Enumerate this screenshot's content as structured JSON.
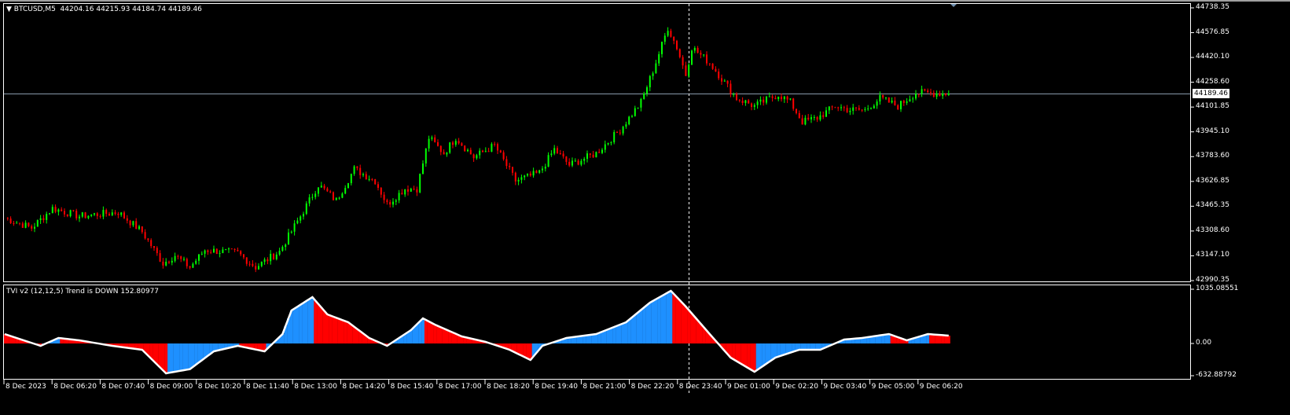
{
  "header": {
    "symbol_label": "BTCUSD,M5",
    "ohlc": "44204.16 44215.93 44184.74 44189.46"
  },
  "indicator": {
    "label": "TVI v2 (12,12,5) Trend is DOWN 152.80977"
  },
  "bid_price": "44189.46",
  "colors": {
    "bull": "#00ff00",
    "bear": "#ff0000",
    "tvi_up": "#1e90ff",
    "tvi_down": "#ff0000",
    "tvi_line": "#ffffff",
    "grid_line": "#8899aa"
  },
  "chart_data": [
    {
      "type": "candlestick",
      "title": "BTCUSD,M5",
      "ylim": [
        42990.35,
        44738.35
      ],
      "price_ticks": [
        "44738.35",
        "44576.85",
        "44420.10",
        "44258.60",
        "44101.85",
        "43945.10",
        "43783.60",
        "43626.85",
        "43465.35",
        "43308.60",
        "43147.10",
        "42990.35"
      ],
      "time_ticks": [
        "8 Dec 2023",
        "8 Dec 06:20",
        "8 Dec 07:40",
        "8 Dec 09:00",
        "8 Dec 10:20",
        "8 Dec 11:40",
        "8 Dec 13:00",
        "8 Dec 14:20",
        "8 Dec 15:40",
        "8 Dec 17:00",
        "8 Dec 18:20",
        "8 Dec 19:40",
        "8 Dec 21:00",
        "8 Dec 22:20",
        "8 Dec 23:40",
        "9 Dec 01:00",
        "9 Dec 02:20",
        "9 Dec 03:40",
        "9 Dec 05:00",
        "9 Dec 06:20"
      ],
      "close_waypoints": {
        "bar": [
          0,
          9,
          16,
          25,
          38,
          46,
          53,
          57,
          62,
          67,
          78,
          84,
          92,
          99,
          105,
          111,
          117,
          124,
          128,
          134,
          138,
          142,
          147,
          151,
          157,
          164,
          171,
          179,
          184,
          189,
          198,
          206,
          213,
          217,
          222,
          225,
          228,
          230,
          236,
          241,
          245,
          251,
          259,
          263,
          267,
          272,
          278,
          283,
          288,
          293,
          299,
          305,
          316
        ],
        "price": [
          43392,
          43328,
          43454,
          43403,
          43429,
          43303,
          43101,
          43152,
          43076,
          43187,
          43167,
          43076,
          43177,
          43403,
          43605,
          43504,
          43706,
          43630,
          43479,
          43580,
          43580,
          43907,
          43806,
          43907,
          43781,
          43857,
          43630,
          43681,
          43832,
          43731,
          43806,
          43957,
          44134,
          44335,
          44612,
          44486,
          44310,
          44486,
          44386,
          44260,
          44159,
          44109,
          44184,
          44134,
          44008,
          44033,
          44109,
          44084,
          44084,
          44159,
          44109,
          44194,
          44189.46
        ]
      }
    },
    {
      "type": "area",
      "title": "TVI v2 (12,12,5)",
      "ylim": [
        -632.88792,
        1035.08551
      ],
      "value_ticks": [
        "1035.08551",
        "0.00",
        "-632.88792"
      ],
      "waypoints": {
        "bar": [
          0,
          12,
          18,
          25,
          36,
          46,
          54,
          62,
          70,
          78,
          87,
          93,
          96,
          103,
          108,
          115,
          122,
          128,
          136,
          140,
          144,
          153,
          161,
          169,
          176,
          180,
          188,
          198,
          208,
          216,
          223,
          228,
          236,
          243,
          251,
          258,
          266,
          273,
          281,
          287,
          296,
          302,
          309,
          316
        ],
        "value": [
          180,
          -45,
          105,
          60,
          -45,
          -120,
          -570,
          -490,
          -150,
          -45,
          -150,
          180,
          630,
          885,
          555,
          405,
          105,
          -45,
          255,
          480,
          360,
          135,
          30,
          -120,
          -315,
          -45,
          105,
          180,
          405,
          780,
          1005,
          705,
          180,
          -270,
          -540,
          -270,
          -120,
          -120,
          75,
          105,
          180,
          60,
          180,
          150
        ]
      }
    }
  ]
}
